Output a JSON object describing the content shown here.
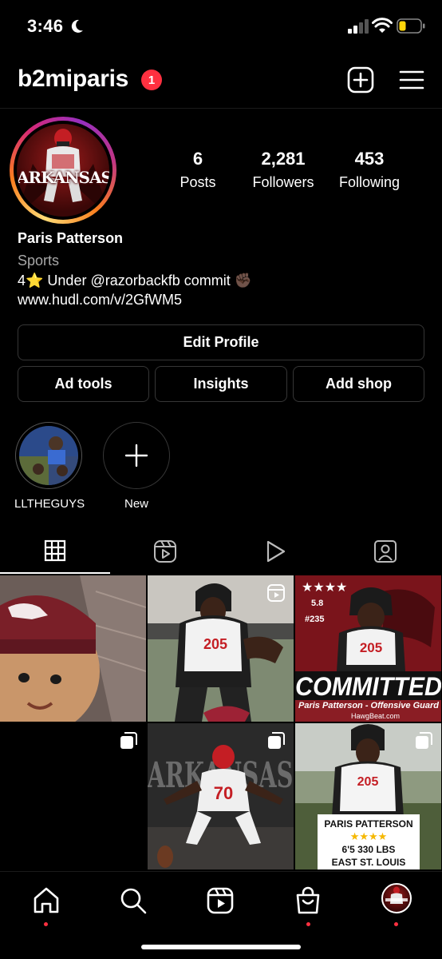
{
  "status_bar": {
    "time": "3:46",
    "battery_color": "#ffd60a"
  },
  "header": {
    "username": "b2miparis",
    "notification_count": "1"
  },
  "profile": {
    "stats": [
      {
        "value": "6",
        "label": "Posts"
      },
      {
        "value": "2,281",
        "label": "Followers"
      },
      {
        "value": "453",
        "label": "Following"
      }
    ],
    "name": "Paris Patterson",
    "category": "Sports",
    "bio_line": "4⭐ Under   @razorbackfb commit ✊🏿",
    "link": "www.hudl.com/v/2GfWM5",
    "avatar_text": "ARKANSAS"
  },
  "buttons": {
    "edit_profile": "Edit Profile",
    "ad_tools": "Ad tools",
    "insights": "Insights",
    "add_shop": "Add shop"
  },
  "highlights": [
    {
      "label": "LLTHEGUYS"
    },
    {
      "label": "New"
    }
  ],
  "tabs": [
    "grid-icon",
    "reels-icon",
    "play-icon",
    "tagged-icon"
  ],
  "posts": [
    {
      "texts": []
    },
    {
      "texts": [
        "205"
      ]
    },
    {
      "texts": [
        "5.8",
        "#235",
        "205",
        "COMMITTED",
        "Paris Patterson - Offensive Guard",
        "HawgBeat.com"
      ]
    },
    {
      "texts": []
    },
    {
      "texts": [
        "ARKANSAS",
        "70"
      ]
    },
    {
      "texts": [
        "205",
        "PARIS PATTERSON",
        "6'5 330 LBS",
        "EAST ST. LOUIS"
      ]
    }
  ],
  "bottom_nav": [
    "home-icon",
    "search-icon",
    "reels-icon",
    "shop-icon",
    "profile-avatar"
  ],
  "colors": {
    "accent": "#ff3040",
    "border": "#363636",
    "secondary_text": "#a8a8a8",
    "razorback_red": "#9d2235"
  }
}
